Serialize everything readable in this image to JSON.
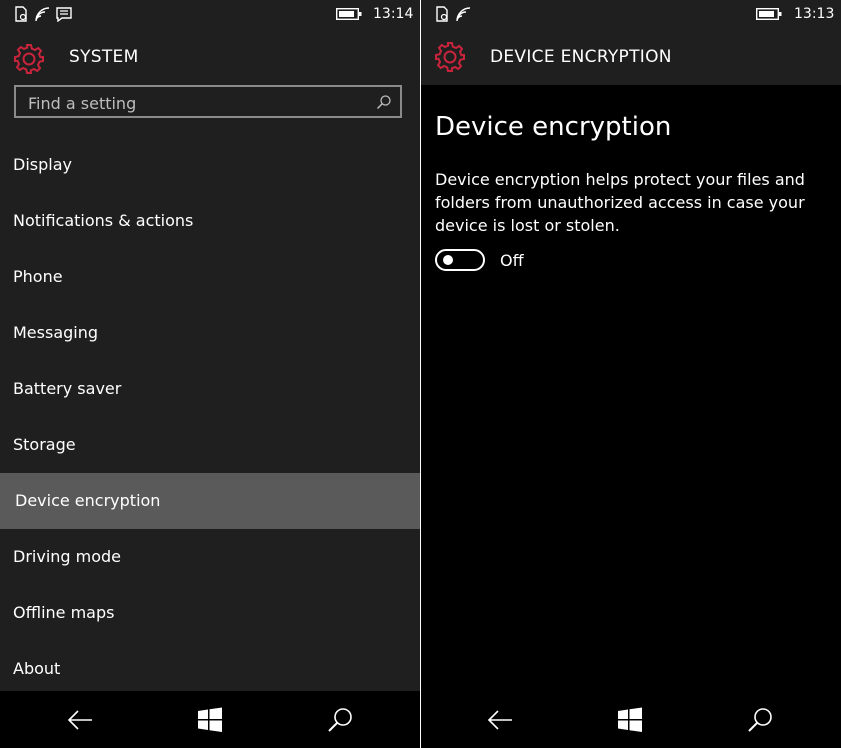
{
  "left": {
    "clock": "13:14",
    "header_title": "SYSTEM",
    "search_placeholder": "Find a setting",
    "items": [
      {
        "label": "Display"
      },
      {
        "label": "Notifications & actions"
      },
      {
        "label": "Phone"
      },
      {
        "label": "Messaging"
      },
      {
        "label": "Battery saver"
      },
      {
        "label": "Storage"
      },
      {
        "label": "Device encryption",
        "selected": true
      },
      {
        "label": "Driving mode"
      },
      {
        "label": "Offline maps"
      },
      {
        "label": "About"
      }
    ]
  },
  "right": {
    "clock": "13:13",
    "header_title": "DEVICE ENCRYPTION",
    "title": "Device encryption",
    "description": "Device encryption helps protect your files and folders from unauthorized access in case your device is lost or stolen.",
    "toggle": {
      "state": "off",
      "label": "Off"
    }
  },
  "icons": [
    "sim-icon",
    "wifi-icon",
    "message-icon",
    "battery-icon",
    "gear-icon",
    "search-icon",
    "back-icon",
    "windows-icon",
    "cortana-search-icon"
  ],
  "colors": {
    "accent": "#c8243c",
    "selected_bg": "#5a5a5a",
    "panel_bg": "#1f1f1f",
    "navbar_bg": "#000000"
  }
}
